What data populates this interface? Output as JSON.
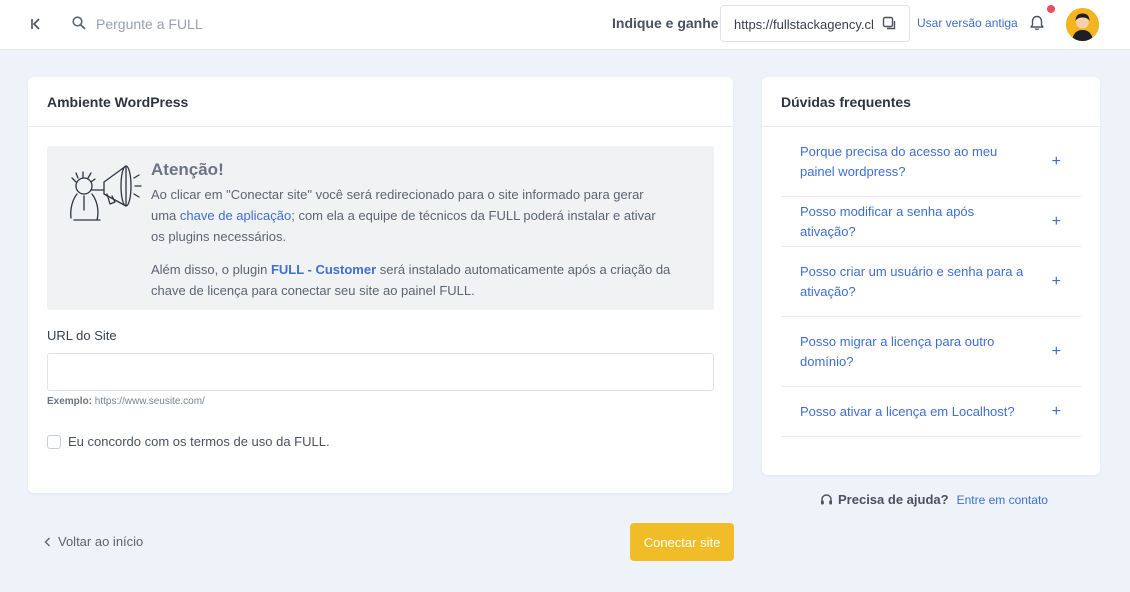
{
  "header": {
    "search_placeholder": "Pergunte a FULL",
    "refer_label": "Indique e ganhe:",
    "refer_url": "https://fullstackagency.club/?ref=",
    "old_version": "Usar versão antiga"
  },
  "main": {
    "title": "Ambiente WordPress",
    "alert": {
      "title": "Atenção!",
      "p1_before": "Ao clicar em \"Conectar site\" você será redirecionado para o site informado para gerar uma ",
      "p1_link": "chave de aplicação",
      "p1_after": "; com ela a equipe de técnicos da FULL poderá instalar e ativar os plugins necessários.",
      "p2_before": "Além disso, o plugin ",
      "p2_link": "FULL - Customer",
      "p2_after": " será instalado automaticamente após a criação da chave de licença para conectar seu site ao painel FULL."
    },
    "url_label": "URL do Site",
    "url_value": "",
    "url_hint_label": "Exemplo:",
    "url_hint_value": "https://www.seusite.com/",
    "terms_label": "Eu concordo com os termos de uso da FULL."
  },
  "actions": {
    "back": "Voltar ao início",
    "connect": "Conectar site"
  },
  "faq": {
    "title": "Dúvidas frequentes",
    "items": [
      {
        "q": "Porque precisa do acesso ao meu painel wordpress?"
      },
      {
        "q": "Posso modificar a senha após ativação?"
      },
      {
        "q": "Posso criar um usuário e senha para a ativação?"
      },
      {
        "q": "Posso migrar a licença para outro domínio?"
      },
      {
        "q": "Posso ativar a licença em Localhost?"
      }
    ]
  },
  "help": {
    "label": "Precisa de ajuda?",
    "link": "Entre em contato"
  },
  "colors": {
    "accent": "#3f6fd1",
    "button": "#f0bd28",
    "notification": "#ee4c5f",
    "background": "#eef2f9"
  },
  "icons": [
    "collapse-icon",
    "search-icon",
    "copy-icon",
    "bell-icon",
    "avatar",
    "megaphone-illustration",
    "chevron-left-icon",
    "plus-icon",
    "headset-icon"
  ]
}
